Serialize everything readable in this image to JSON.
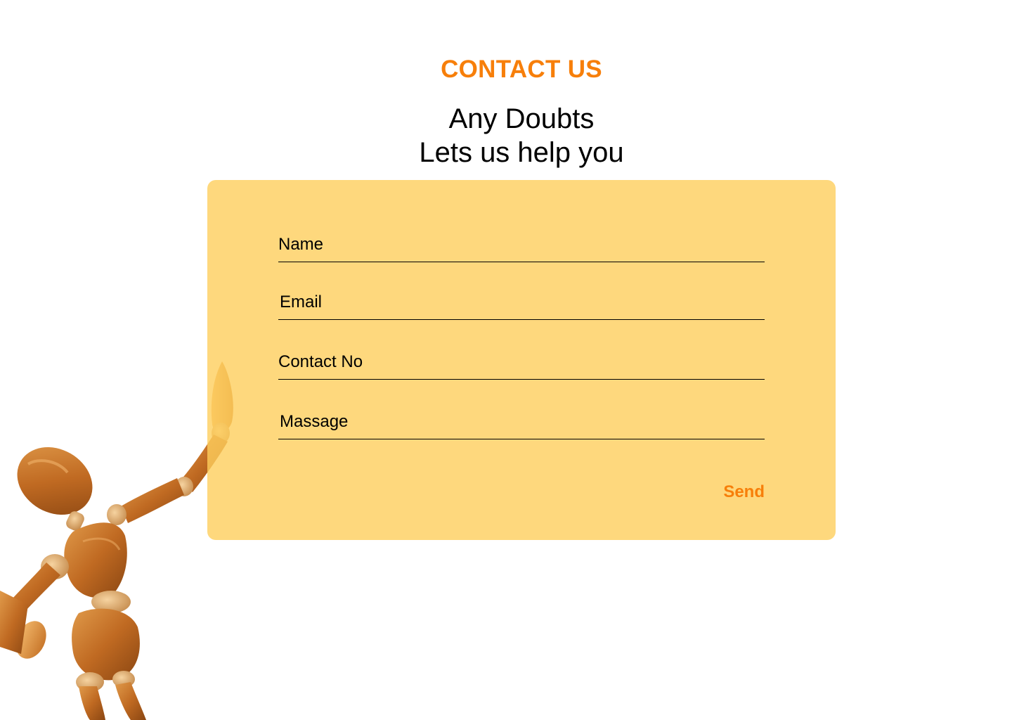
{
  "section_title": "CONTACT US",
  "headline": {
    "line1": "Any Doubts",
    "line2": "Lets us help you"
  },
  "form": {
    "fields": [
      {
        "label": "Name"
      },
      {
        "label": "Email"
      },
      {
        "label": "Contact No"
      },
      {
        "label": "Massage"
      }
    ],
    "send_label": "Send"
  },
  "colors": {
    "accent": "#f77f0a",
    "card": "#fed25c",
    "text": "#000000"
  },
  "decoration": {
    "image": "wooden-mannequin-figure"
  }
}
